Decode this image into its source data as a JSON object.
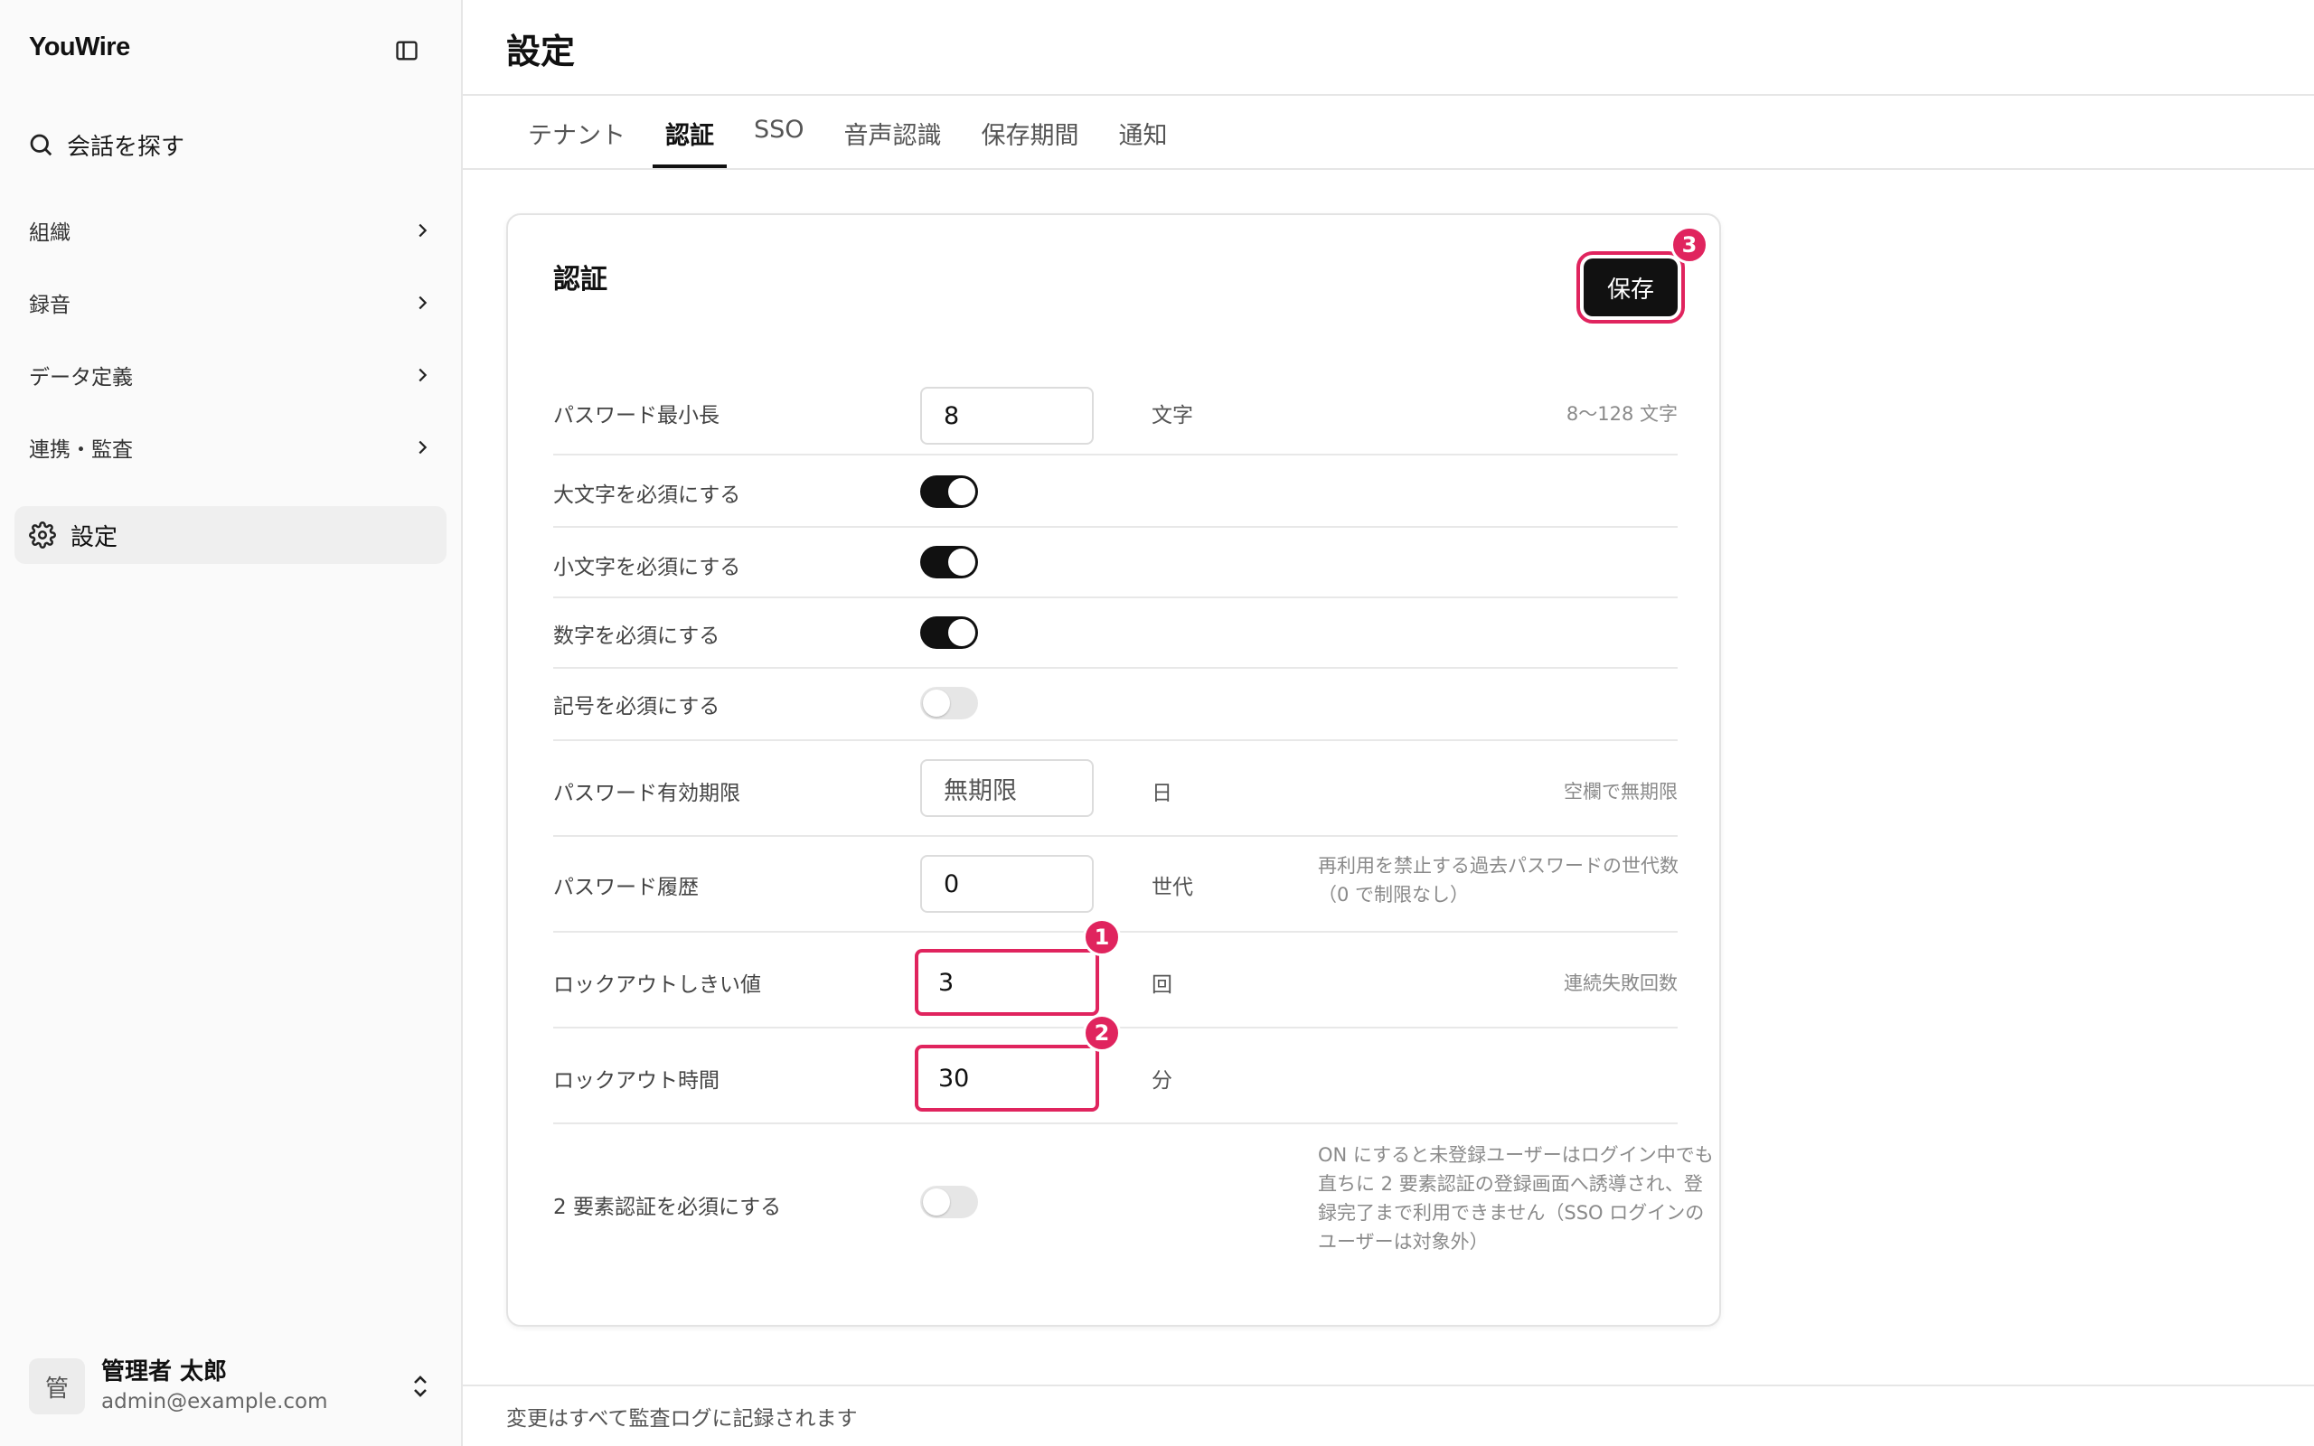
{
  "sidebar": {
    "brand": "YouWire",
    "search_label": "会話を探す",
    "items": [
      {
        "label": "組織"
      },
      {
        "label": "録音"
      },
      {
        "label": "データ定義"
      },
      {
        "label": "連携・監査"
      }
    ],
    "active_item": {
      "label": "設定"
    },
    "user": {
      "avatar_initial": "管",
      "name": "管理者 太郎",
      "email": "admin@example.com"
    }
  },
  "header": {
    "title": "設定",
    "tabs": [
      {
        "label": "テナント",
        "active": false
      },
      {
        "label": "認証",
        "active": true
      },
      {
        "label": "SSO",
        "active": false
      },
      {
        "label": "音声認識",
        "active": false
      },
      {
        "label": "保存期間",
        "active": false
      },
      {
        "label": "通知",
        "active": false
      }
    ]
  },
  "card": {
    "title": "認証",
    "save_label": "保存",
    "badges": [
      "1",
      "2",
      "3"
    ],
    "rows": {
      "min_length": {
        "label": "パスワード最小長",
        "value": "8",
        "unit": "文字",
        "hint": "8〜128 文字"
      },
      "uppercase": {
        "label": "大文字を必須にする",
        "state": "on"
      },
      "lowercase": {
        "label": "小文字を必須にする",
        "state": "on"
      },
      "digit": {
        "label": "数字を必須にする",
        "state": "on"
      },
      "symbol": {
        "label": "記号を必須にする",
        "state": "off"
      },
      "expiry": {
        "label": "パスワード有効期限",
        "placeholder": "無期限",
        "unit": "日",
        "hint": "空欄で無期限"
      },
      "history": {
        "label": "パスワード履歴",
        "value": "0",
        "unit": "世代",
        "hint": "再利用を禁止する過去パスワードの世代数（0 で制限なし）"
      },
      "lockout_threshold": {
        "label": "ロックアウトしきい値",
        "value": "3",
        "unit": "回",
        "hint": "連続失敗回数"
      },
      "lockout_time": {
        "label": "ロックアウト時間",
        "value": "30",
        "unit": "分"
      },
      "mfa": {
        "label": "2 要素認証を必須にする",
        "state": "off",
        "hint": "ON にすると未登録ユーザーはログイン中でも直ちに 2 要素認証の登録画面へ誘導され、登録完了まで利用できません（SSO ログインのユーザーは対象外）"
      }
    }
  },
  "footer": {
    "note": "変更はすべて監査ログに記録されます"
  },
  "colors": {
    "accent": "#111111",
    "highlight": "#e0245e",
    "sidebar_bg": "#fafafa"
  }
}
